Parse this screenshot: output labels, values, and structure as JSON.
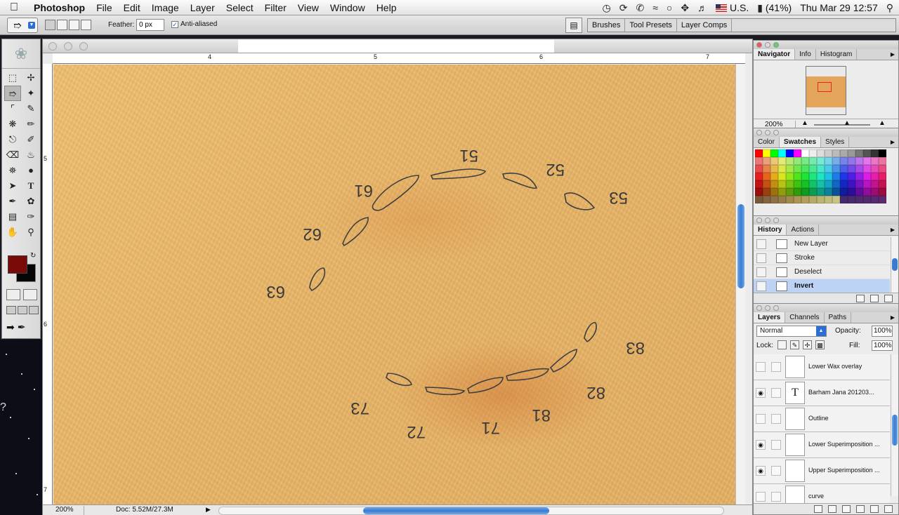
{
  "menubar": {
    "app_name": "Photoshop",
    "items": [
      "File",
      "Edit",
      "Image",
      "Layer",
      "Select",
      "Filter",
      "View",
      "Window",
      "Help"
    ],
    "input_source": "U.S.",
    "battery": "(41%)",
    "clock": "Thu Mar 29  12:57"
  },
  "options": {
    "feather_label": "Feather:",
    "feather_value": "0 px",
    "antialias_label": "Anti-aliased",
    "antialias_checked": true,
    "well_tabs": [
      "Brushes",
      "Tool Presets",
      "Layer Comps"
    ]
  },
  "toolbox": {
    "foreground_color": "#7a0a08",
    "background_color": "#050505",
    "tools": [
      "rect-marquee",
      "move",
      "lasso",
      "magic-wand",
      "crop",
      "slice",
      "healing-brush",
      "brush",
      "clone-stamp",
      "history-brush",
      "eraser",
      "paint-bucket",
      "blur",
      "dodge",
      "path-select",
      "type",
      "pen",
      "custom-shape",
      "notes",
      "eyedropper",
      "hand",
      "zoom"
    ],
    "selected_tool": "lasso"
  },
  "document": {
    "ruler_h": [
      "4",
      "5",
      "6",
      "7"
    ],
    "ruler_v": [
      "5",
      "6",
      "7"
    ],
    "zoom": "200%",
    "doc_size": "Doc: 5.52M/27.3M",
    "labels": [
      "51",
      "52",
      "53",
      "61",
      "62",
      "63",
      "73",
      "72",
      "71",
      "81",
      "82",
      "83"
    ]
  },
  "navigator": {
    "tabs": [
      "Navigator",
      "Info",
      "Histogram"
    ],
    "active": "Navigator",
    "zoom": "200%"
  },
  "swatches": {
    "tabs": [
      "Color",
      "Swatches",
      "Styles"
    ],
    "active": "Swatches"
  },
  "history": {
    "tabs": [
      "History",
      "Actions"
    ],
    "active": "History",
    "items": [
      "New Layer",
      "Stroke",
      "Deselect",
      "Invert"
    ],
    "selected": "Invert"
  },
  "layers": {
    "tabs": [
      "Layers",
      "Channels",
      "Paths"
    ],
    "active": "Layers",
    "blend_mode": "Normal",
    "opacity_label": "Opacity:",
    "opacity": "100%",
    "lock_label": "Lock:",
    "fill_label": "Fill:",
    "fill": "100%",
    "rows": [
      {
        "name": "Lower Wax overlay",
        "visible": false,
        "thumb": ""
      },
      {
        "name": "Barham Jana 201203...",
        "visible": true,
        "thumb": "T"
      },
      {
        "name": "Outline",
        "visible": false,
        "thumb": ""
      },
      {
        "name": "Lower Superimposition ...",
        "visible": true,
        "thumb": ""
      },
      {
        "name": "Upper Superimposition ...",
        "visible": true,
        "thumb": ""
      },
      {
        "name": "curve",
        "visible": false,
        "thumb": ""
      }
    ]
  }
}
